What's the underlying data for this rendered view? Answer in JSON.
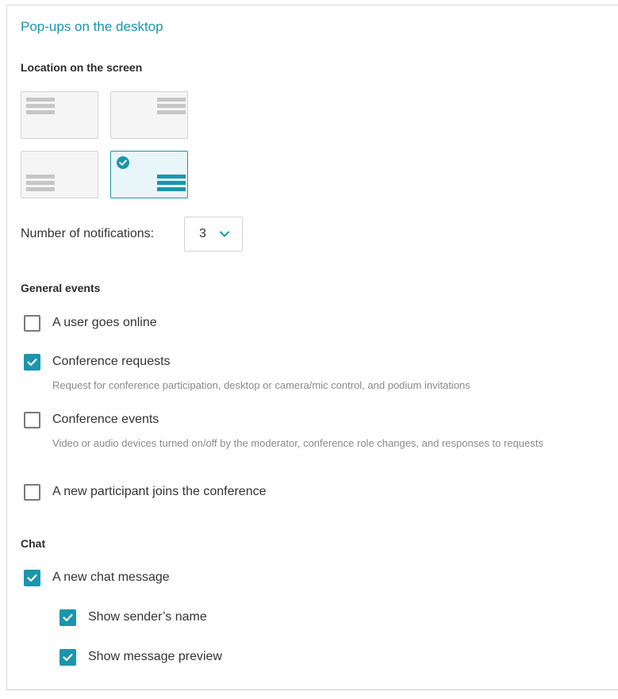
{
  "section_title": "Pop-ups on the desktop",
  "location": {
    "heading": "Location on the screen",
    "options": [
      {
        "id": "top-left",
        "selected": false
      },
      {
        "id": "top-right",
        "selected": false
      },
      {
        "id": "bottom-left",
        "selected": false
      },
      {
        "id": "bottom-right",
        "selected": true
      }
    ]
  },
  "notifications": {
    "label": "Number of notifications:",
    "value": "3"
  },
  "general_events": {
    "heading": "General events",
    "items": [
      {
        "label": "A user goes online",
        "checked": false,
        "description": ""
      },
      {
        "label": "Conference requests",
        "checked": true,
        "description": "Request for conference participation, desktop or camera/mic control, and podium invitations"
      },
      {
        "label": "Conference events",
        "checked": false,
        "description": "Video or audio devices turned on/off by the moderator, conference role changes, and responses to requests"
      },
      {
        "label": "A new participant joins the conference",
        "checked": false,
        "description": ""
      }
    ]
  },
  "chat": {
    "heading": "Chat",
    "new_message": {
      "label": "A new chat message",
      "checked": true
    },
    "sub_items": [
      {
        "label": "Show sender’s name",
        "checked": true
      },
      {
        "label": "Show message preview",
        "checked": true
      }
    ]
  },
  "colors": {
    "accent": "#1a96ad",
    "tile_bg": "#f5f5f5",
    "tile_selected_bg": "#e8f6f9"
  }
}
